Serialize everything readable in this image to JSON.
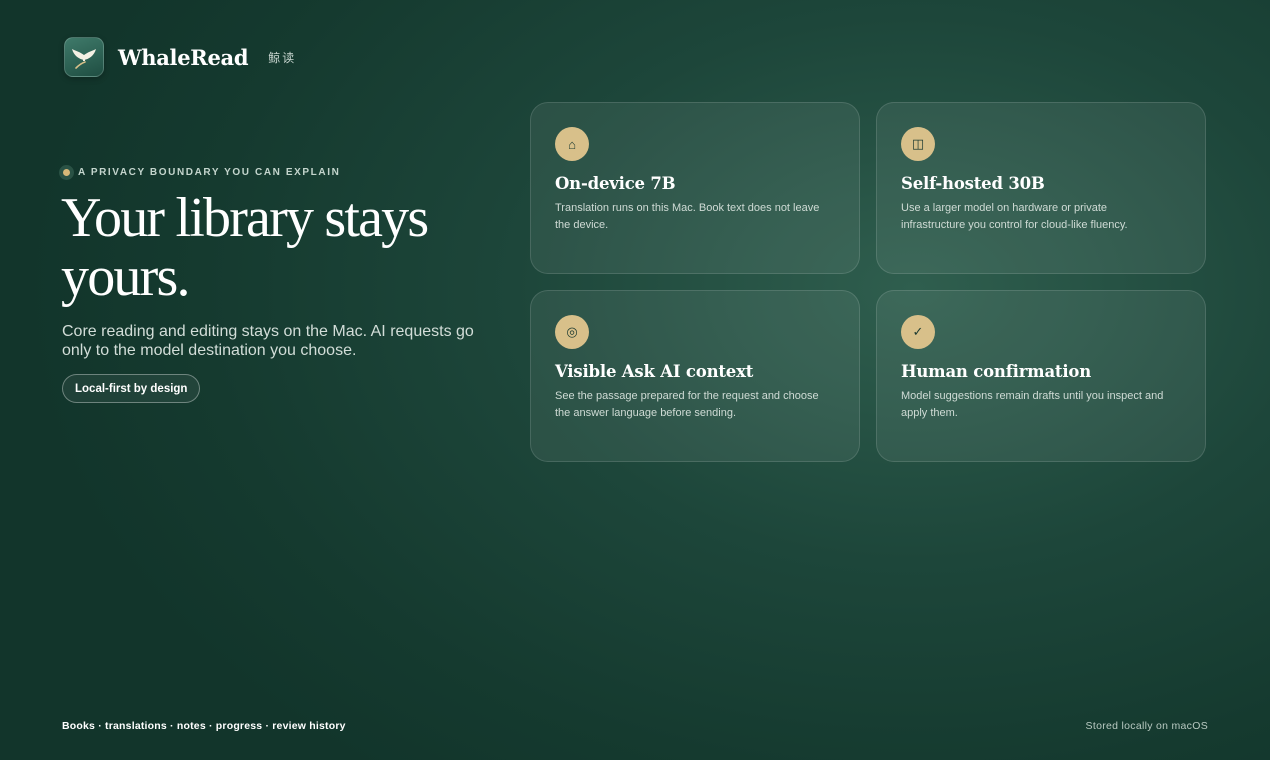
{
  "brand": {
    "name": "WhaleRead",
    "subtitle_cn": "鲸读",
    "icon": "whale-tail-icon"
  },
  "hero": {
    "eyebrow": "A PRIVACY BOUNDARY YOU CAN EXPLAIN",
    "headline": "Your library stays yours.",
    "subtitle": "Core reading and editing stays on the Mac. AI requests go only to the model destination you choose.",
    "pill": "Local-first by design"
  },
  "cards": [
    {
      "icon": "home-icon",
      "glyph": "⌂",
      "title": "On-device 7B",
      "description": "Translation runs on this Mac. Book text does not leave the device."
    },
    {
      "icon": "server-icon",
      "glyph": "◫",
      "title": "Self-hosted 30B",
      "description": "Use a larger model on hardware or private infrastructure you control for cloud-like fluency."
    },
    {
      "icon": "target-icon",
      "glyph": "◎",
      "title": "Visible Ask AI context",
      "description": "See the passage prepared for the request and choose the answer language before sending."
    },
    {
      "icon": "checkmark-icon",
      "glyph": "✓",
      "title": "Human confirmation",
      "description": "Model suggestions remain drafts until you inspect and apply them."
    }
  ],
  "footer": {
    "left": "Books · translations · notes · progress · review history",
    "right": "Stored locally on macOS"
  },
  "colors": {
    "background": "#1d463a",
    "accent": "#d8c08a",
    "text": "#ffffff"
  }
}
